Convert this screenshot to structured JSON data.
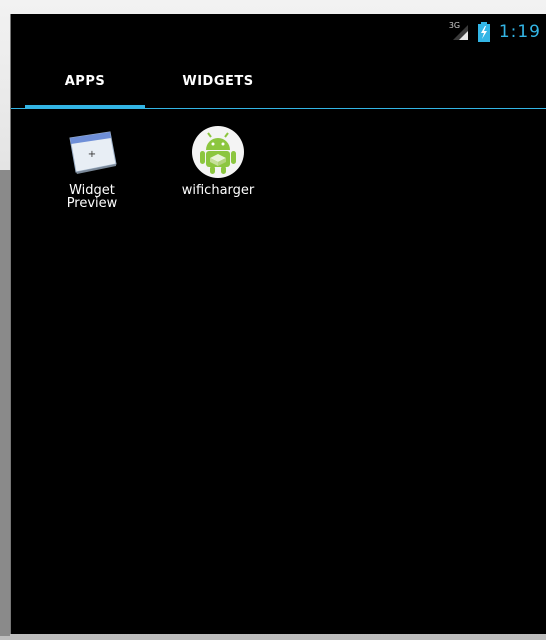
{
  "status_bar": {
    "network_type": "3G",
    "clock": "1:19",
    "icons": [
      "signal-icon",
      "battery-charging-icon"
    ]
  },
  "tabs": [
    {
      "label": "APPS",
      "selected": true
    },
    {
      "label": "WIDGETS",
      "selected": false
    }
  ],
  "apps": [
    {
      "label_line1": "Widget",
      "label_line2": "Preview",
      "icon": "widget-preview-icon"
    },
    {
      "label_line1": "wificharger",
      "label_line2": "",
      "icon": "android-robot-icon"
    }
  ],
  "colors": {
    "accent": "#33b5e5",
    "background": "#000000",
    "text": "#ffffff",
    "android_green": "#8cc63f"
  }
}
